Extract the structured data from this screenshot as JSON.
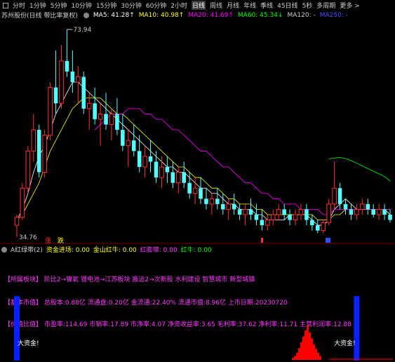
{
  "toolbar": {
    "items": [
      "分时",
      "1分钟",
      "5分钟",
      "10分钟",
      "15分钟",
      "30分钟",
      "60分钟",
      "2小时",
      "日线",
      "周线",
      "月线",
      "年线",
      "季线",
      "45日线",
      "5秒",
      "多周期",
      "更多 >"
    ],
    "active_index": 8
  },
  "indicator_bar": {
    "name": "苏州股份(日线 带比率复权)",
    "ma5": "MA5: 41.28↑",
    "ma10": "MA10: 40.98↑",
    "ma20": "MA20: 41.69↑",
    "ma60": "MA60: 45.34↓",
    "ma120": "MA120: -",
    "ma250": "MA250: -"
  },
  "price_labels": {
    "high": "73.94",
    "low": "34.76"
  },
  "markers": [
    "涨",
    "跌"
  ],
  "sub_bar": {
    "title": "A红绿带(2)",
    "fund_flow": "资金进场: 0.00",
    "golden": "金山红牛: 0.00",
    "red_band": "红膨带: 0.00",
    "red_cow": "红牛: 0.00"
  },
  "info_lines": [
    "【所属板块】 阶比2→镍氧 锂电池→江苏板块 搬运2→次新股 水利建设 智慧城市 新型城镇",
    "【基本市值】 总股本:0.88亿 流通盘:0.20亿 金流通:22.40% 流通市值:8.96亿 上市日期:20230720",
    "【价值比值】 市盈率:114.69 市销率:17.89 市净率:4.07 净资收益率:3.65 毛利率:37.62 净利率:11.71 主营利润率:12.88"
  ],
  "big_fund_label": "大资金!",
  "colors": {
    "up": "#ff3232",
    "down": "#54ffff",
    "ma5": "#ffffff",
    "ma10": "#ffff00",
    "ma20": "#ff00ff",
    "ma60": "#00ff00",
    "info": "#ff3bff",
    "bar_blue": "#0a20ff",
    "bar_red": "#ff0000"
  },
  "chart_data": {
    "type": "candlestick",
    "ylim": [
      34.76,
      73.94
    ],
    "candles": [
      [
        37,
        39,
        34.8,
        38.5
      ],
      [
        38.5,
        45,
        38,
        44
      ],
      [
        44,
        52,
        43,
        51
      ],
      [
        51,
        58,
        49,
        55
      ],
      [
        55,
        56,
        46,
        47
      ],
      [
        47,
        55,
        46,
        54
      ],
      [
        54,
        64,
        53,
        63
      ],
      [
        63,
        70,
        58,
        60
      ],
      [
        60,
        71,
        59,
        68
      ],
      [
        68,
        73.94,
        65,
        66
      ],
      [
        66,
        70,
        62,
        64
      ],
      [
        64,
        67,
        60,
        65
      ],
      [
        65,
        66,
        58,
        59
      ],
      [
        59,
        62,
        55,
        60
      ],
      [
        60,
        63,
        56,
        57
      ],
      [
        57,
        60,
        52,
        58
      ],
      [
        58,
        62,
        55,
        56
      ],
      [
        56,
        59,
        53,
        58
      ],
      [
        58,
        61,
        54,
        55
      ],
      [
        55,
        58,
        51,
        52
      ],
      [
        52,
        55,
        48,
        53
      ],
      [
        53,
        56,
        50,
        51
      ],
      [
        51,
        54,
        47,
        48
      ],
      [
        48,
        52,
        46,
        50
      ],
      [
        50,
        53,
        47,
        49
      ],
      [
        49,
        51,
        45,
        46
      ],
      [
        46,
        50,
        44,
        48
      ],
      [
        48,
        50,
        45,
        47
      ],
      [
        47,
        49,
        44,
        45
      ],
      [
        45,
        48,
        43,
        47
      ],
      [
        47,
        49,
        44,
        45
      ],
      [
        45,
        47,
        42,
        43
      ],
      [
        43,
        46,
        41,
        44
      ],
      [
        44,
        46,
        41,
        42
      ],
      [
        42,
        44,
        40,
        41
      ],
      [
        41,
        43,
        39,
        42
      ],
      [
        42,
        44,
        40,
        41
      ],
      [
        41,
        43,
        39,
        40
      ],
      [
        40,
        42,
        38,
        41
      ],
      [
        41,
        43,
        39,
        40
      ],
      [
        40,
        41,
        38,
        39
      ],
      [
        39,
        41,
        37,
        40
      ],
      [
        40,
        42,
        38,
        39
      ],
      [
        39,
        41,
        37,
        38
      ],
      [
        38,
        40,
        36,
        37
      ],
      [
        37,
        39,
        36,
        38
      ],
      [
        38,
        40,
        37,
        39
      ],
      [
        39,
        41,
        38,
        40
      ],
      [
        40,
        41,
        38,
        39
      ],
      [
        39,
        40,
        37,
        38
      ],
      [
        38,
        40,
        37,
        39
      ],
      [
        39,
        41,
        38,
        40
      ],
      [
        40,
        41,
        37,
        38
      ],
      [
        38,
        39,
        36,
        37
      ],
      [
        37,
        38,
        35.5,
        36
      ],
      [
        36,
        38,
        35.5,
        37.5
      ],
      [
        37.5,
        42,
        37,
        41
      ],
      [
        41,
        49,
        40,
        44
      ],
      [
        44,
        45,
        40,
        41
      ],
      [
        41,
        42,
        39,
        40
      ],
      [
        40,
        41,
        38,
        39
      ],
      [
        39,
        41,
        38,
        40
      ],
      [
        40,
        42,
        39,
        41
      ],
      [
        41,
        42,
        39,
        40
      ],
      [
        40,
        41,
        38.5,
        39
      ],
      [
        39,
        41,
        38,
        40
      ],
      [
        40,
        41,
        38,
        39
      ],
      [
        39,
        40,
        37.5,
        38
      ]
    ],
    "ma_lines": {
      "ma5": [
        38,
        40,
        43,
        47,
        50,
        52,
        55,
        58,
        60,
        62,
        64,
        64,
        63,
        62,
        61,
        60,
        59,
        58,
        57,
        56,
        55,
        54,
        53,
        52,
        51,
        50,
        49,
        48,
        48,
        47,
        47,
        46,
        45,
        44,
        44,
        43,
        43,
        42,
        41,
        41,
        40,
        40,
        40,
        39,
        39,
        38,
        38,
        38,
        38,
        39,
        39,
        39,
        39,
        38,
        37,
        37,
        38,
        40,
        41,
        42,
        41,
        40,
        40,
        40,
        40,
        40,
        40,
        39
      ],
      "ma10": [
        38,
        39,
        41,
        43,
        45,
        48,
        51,
        53,
        55,
        57,
        59,
        60,
        61,
        61,
        61,
        61,
        60,
        59,
        58,
        58,
        57,
        56,
        55,
        54,
        53,
        52,
        51,
        50,
        49,
        48,
        48,
        47,
        46,
        46,
        45,
        44,
        44,
        43,
        42,
        42,
        41,
        41,
        41,
        40,
        40,
        39,
        39,
        39,
        39,
        39,
        39,
        39,
        39,
        39,
        38,
        38,
        38,
        39,
        39,
        40,
        40,
        40,
        40,
        40,
        40,
        40,
        40,
        40
      ],
      "ma20": [
        null,
        null,
        null,
        null,
        null,
        null,
        null,
        null,
        null,
        null,
        null,
        null,
        null,
        null,
        55,
        56,
        57,
        58,
        58,
        58,
        59,
        59,
        59,
        58,
        58,
        57,
        57,
        56,
        55,
        55,
        54,
        53,
        52,
        51,
        51,
        50,
        49,
        48,
        48,
        47,
        46,
        45,
        45,
        44,
        43,
        43,
        42,
        42,
        41,
        41,
        41,
        40,
        40,
        40,
        40,
        39,
        39,
        40,
        40,
        40,
        40,
        40,
        40,
        40,
        40,
        40,
        40,
        40
      ],
      "ma60": [
        null,
        null,
        null,
        null,
        null,
        null,
        null,
        null,
        null,
        null,
        null,
        null,
        null,
        null,
        null,
        null,
        null,
        null,
        null,
        null,
        null,
        null,
        null,
        null,
        null,
        null,
        null,
        null,
        null,
        null,
        null,
        null,
        null,
        null,
        null,
        null,
        null,
        null,
        null,
        null,
        null,
        null,
        null,
        null,
        null,
        null,
        null,
        null,
        null,
        null,
        null,
        null,
        null,
        null,
        null,
        null,
        49.5,
        49.7,
        49.8,
        49.6,
        49.2,
        48.7,
        48.2,
        47.7,
        47.2,
        46.7,
        46.2,
        45.34
      ]
    },
    "sub_chart": {
      "blue_bars": [
        0,
        61
      ],
      "red_histogram": [
        0.05,
        0.1,
        0.18,
        0.3,
        0.45,
        0.6,
        0.75,
        0.88,
        0.7,
        0.55,
        0.4,
        0.28,
        0.18,
        0.1
      ]
    }
  }
}
